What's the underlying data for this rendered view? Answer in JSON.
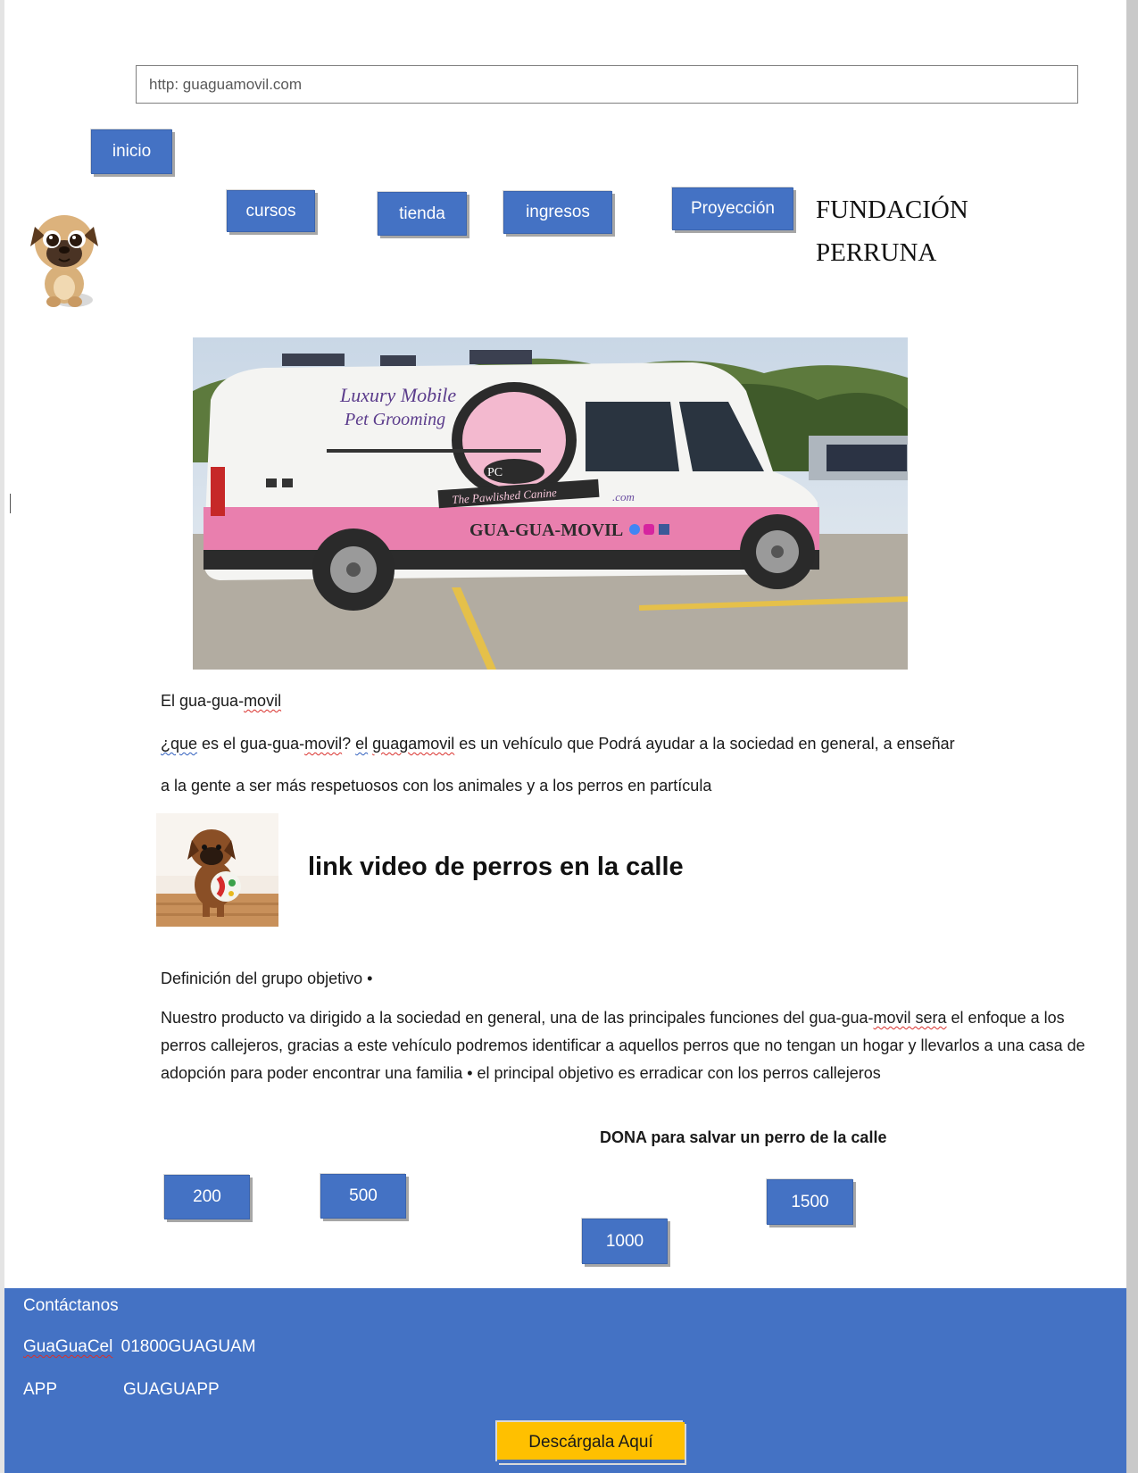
{
  "address_bar": {
    "url": "http: guaguamovil.com"
  },
  "nav": {
    "inicio": "inicio",
    "cursos": "cursos",
    "tienda": "tienda",
    "ingresos": "ingresos",
    "proyeccion": "Proyección"
  },
  "brand": {
    "line1": "FUNDACIÓN",
    "line2": "PERRUNA"
  },
  "hero_image": {
    "caption_top1": "Luxury Mobile",
    "caption_top2": "Pet Grooming",
    "badge": "The Pawlished Canine",
    "badge_suffix": ".com",
    "van_name": "GUA-GUA-MOVIL"
  },
  "intro": {
    "heading_prefix": "El gua-gua-",
    "heading_word": "movil",
    "q_word": "¿que",
    "p1_a": " es el gua-gua-",
    "p1_b": "movil",
    "p1_c": "? ",
    "p1_d": " el",
    "p1_e": "guagamovil",
    "p1_f": " es un vehículo que Podrá ayudar a la sociedad en general, a enseñar",
    "p2": "a la gente a ser más respetuosos con los animales y a los perros en partícula"
  },
  "video_link": {
    "label": "link video de perros en la calle"
  },
  "target": {
    "heading": "Definición del grupo objetivo •",
    "body_a": "Nuestro producto va dirigido a la sociedad en general, una de las principales funciones del gua-gua-",
    "body_b": "movil sera",
    "body_c": " el enfoque a los perros callejeros, gracias a este vehículo podremos identificar a aquellos perros que no tengan un hogar y llevarlos a una casa de adopción para poder encontrar una familia • el principal objetivo es erradicar con los perros callejeros"
  },
  "donate": {
    "heading": "DONA para salvar un perro de la calle",
    "amounts": [
      "200",
      "500",
      "1000",
      "1500"
    ]
  },
  "footer": {
    "contact": "Contáctanos",
    "phone_label": "GuaGuaCel",
    "phone_value": "01800GUAGUAM",
    "app_label": "APP",
    "app_value": "GUAGUAPP",
    "download": "Descárgala Aquí"
  },
  "colors": {
    "button_blue": "#4472c4",
    "download_yellow": "#ffc000"
  }
}
